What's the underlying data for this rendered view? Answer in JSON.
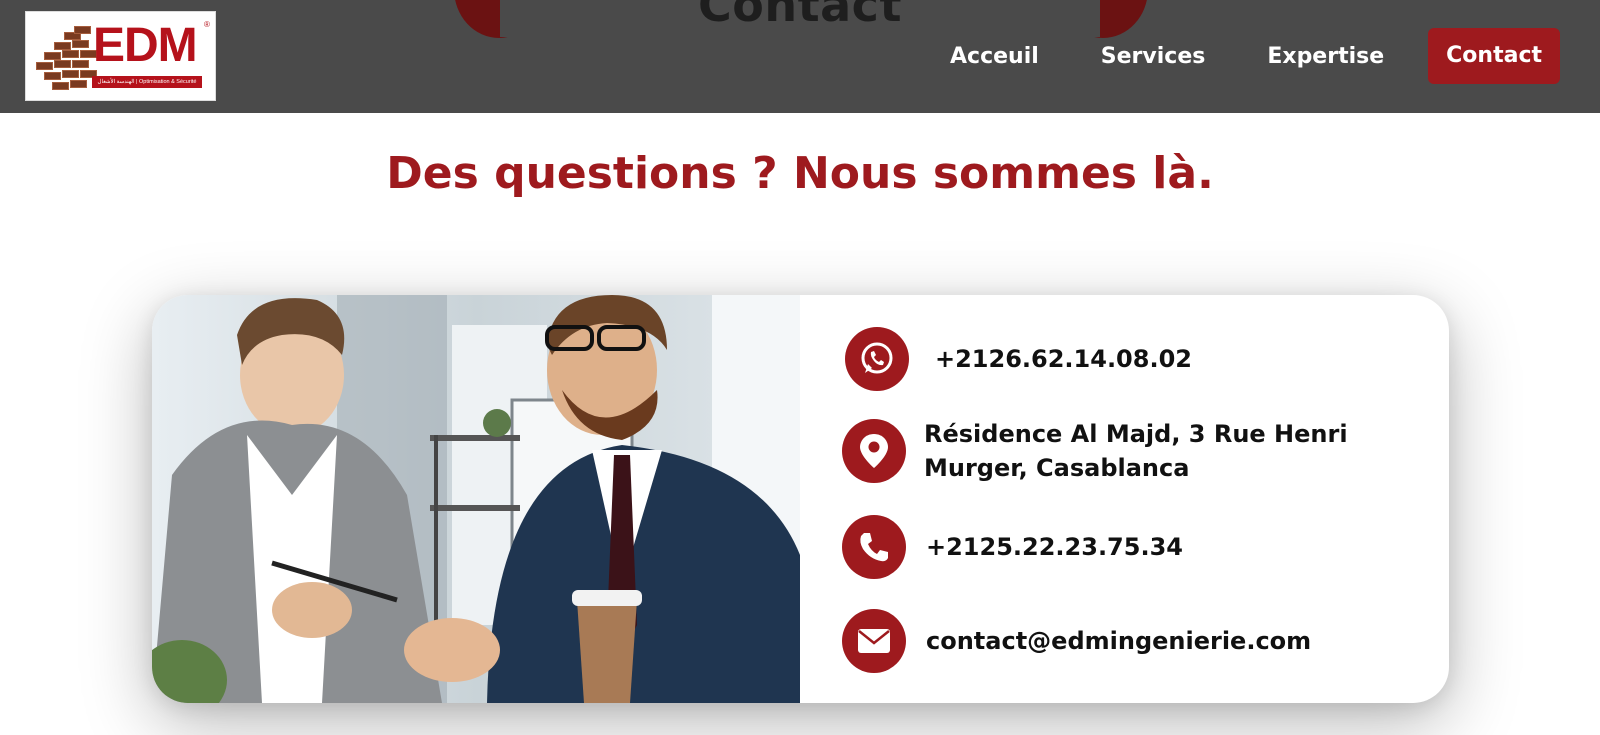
{
  "header": {
    "hero_title": "Contact",
    "logo": {
      "text": "EDM",
      "registered": "®",
      "tagline": "الهندسة الأشغال | Optimisation & Sécurité"
    },
    "nav": [
      {
        "label": "Acceuil",
        "active": false
      },
      {
        "label": "Services",
        "active": false
      },
      {
        "label": "Expertise",
        "active": false
      },
      {
        "label": "Contact",
        "active": true
      }
    ]
  },
  "main": {
    "headline": "Des questions ? Nous sommes là."
  },
  "contact": {
    "whatsapp": {
      "icon": "whatsapp-icon",
      "value": "+2126.62.14.08.02"
    },
    "address": {
      "icon": "location-pin-icon",
      "line1": "Résidence Al Majd, 3 Rue Henri",
      "line2": "Murger, Casablanca"
    },
    "phone": {
      "icon": "phone-icon",
      "value": "+2125.22.23.75.34"
    },
    "email": {
      "icon": "envelope-icon",
      "value": "contact@edmingenierie.com"
    }
  },
  "colors": {
    "brand_red": "#9e1a1e",
    "header_bg": "#4a4a4a",
    "logo_red": "#b5121b"
  }
}
